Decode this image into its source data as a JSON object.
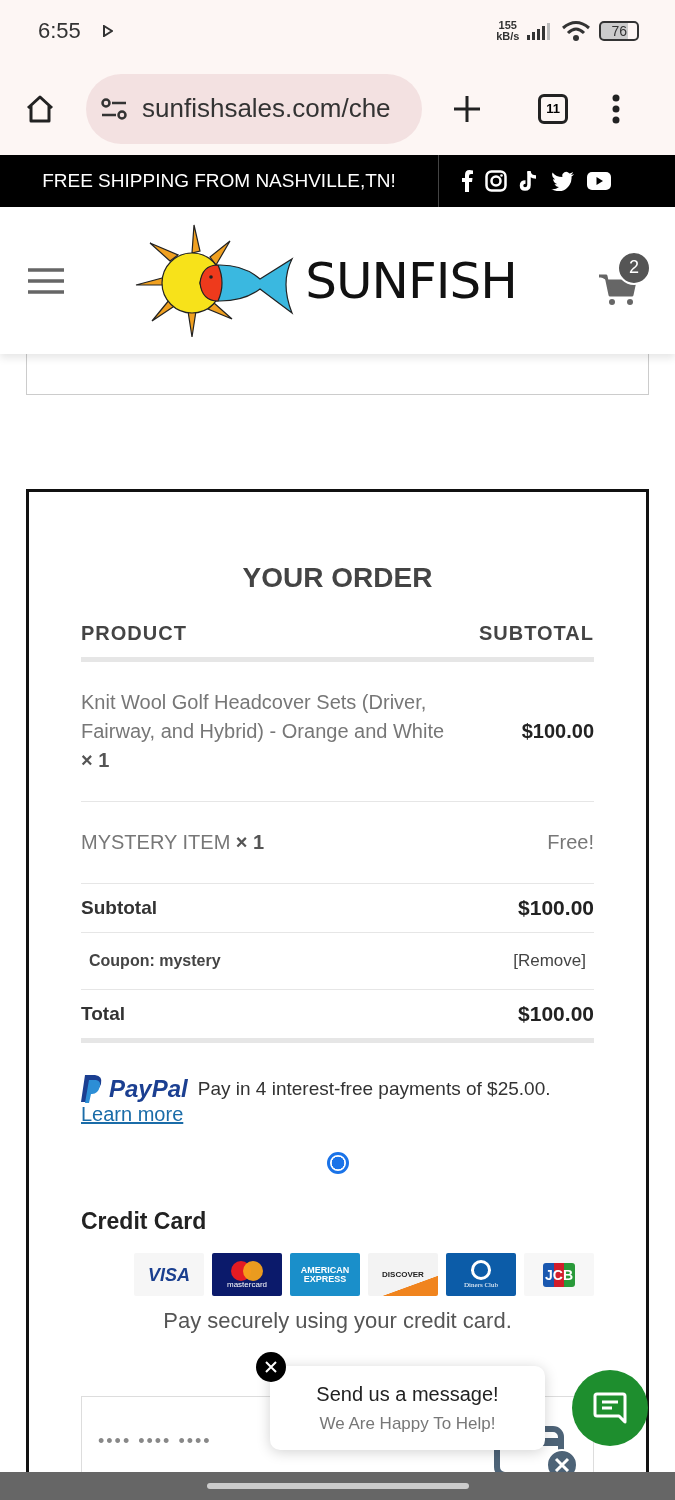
{
  "status_bar": {
    "time": "6:55",
    "speed": "155",
    "speed_unit": "kB/s",
    "battery": "76"
  },
  "browser": {
    "url": "sunfishsales.com/che",
    "tab_count": "11"
  },
  "promo": {
    "text": "FREE SHIPPING FROM NASHVILLE,TN!"
  },
  "header": {
    "brand": "SUNFISH",
    "cart_count": "2"
  },
  "order": {
    "title": "YOUR ORDER",
    "columns": [
      "PRODUCT",
      "SUBTOTAL"
    ],
    "items": [
      {
        "kind": "paid",
        "name": "Knit Wool Golf Headcover Sets (Driver, Fairway, and Hybrid) - Orange and White",
        "qty": "× 1",
        "price": "$100.00"
      },
      {
        "kind": "free",
        "name": "MYSTERY ITEM",
        "qty": "× 1",
        "price": "Free!"
      }
    ],
    "subtotal": {
      "label": "Subtotal",
      "value": "$100.00"
    },
    "coupon": {
      "label": "Coupon: mystery",
      "action": "[Remove]"
    },
    "total": {
      "label": "Total",
      "value": "$100.00"
    }
  },
  "paypal": {
    "logo": "PayPal",
    "message": "Pay in 4 interest-free payments of $25.00.",
    "link": "Learn more",
    "selected": true
  },
  "credit_card": {
    "title": "Credit Card",
    "cards": [
      {
        "kind": "visa",
        "label": "VISA"
      },
      {
        "kind": "mastercard",
        "label": "mastercard"
      },
      {
        "kind": "amex",
        "label": "AMERICAN EXPRESS"
      },
      {
        "kind": "discover",
        "label": "DISCOVER"
      },
      {
        "kind": "diners",
        "label": "Diners Club"
      },
      {
        "kind": "jcb",
        "label": "JCB"
      }
    ],
    "note": "Pay securely using your credit card.",
    "placeholder": "•••• •••• ••••"
  },
  "chat": {
    "title": "Send us a message!",
    "subtitle": "We Are Happy To Help!"
  }
}
